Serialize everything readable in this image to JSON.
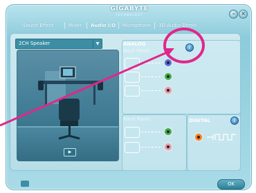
{
  "window": {
    "brand": "GIGABYTE",
    "brand_sub": "TECHNOLOGY"
  },
  "tabs": [
    {
      "label": "Sound Effect"
    },
    {
      "label": "Mixer"
    },
    {
      "label": "Audio I/O",
      "active": true
    },
    {
      "label": "Microphone"
    },
    {
      "label": "3D Audio Demo"
    }
  ],
  "speaker_select": {
    "value": "2CH Speaker"
  },
  "analog": {
    "title": "ANALOG",
    "back_panel": "Back Panel",
    "front_panel": "Front Panel",
    "back_jacks": [
      "#4f6edc",
      "#3fae4a",
      "#e89aa8"
    ],
    "front_jacks": [
      "#3fae4a",
      "#e89aa8"
    ]
  },
  "digital": {
    "title": "DIGITAL"
  },
  "buttons": {
    "ok": "OK",
    "info": "i",
    "play": "▶",
    "minimize": "–",
    "close": "×"
  },
  "colors": {
    "highlight": "#e0278a",
    "accent": "#3b8ea3"
  }
}
